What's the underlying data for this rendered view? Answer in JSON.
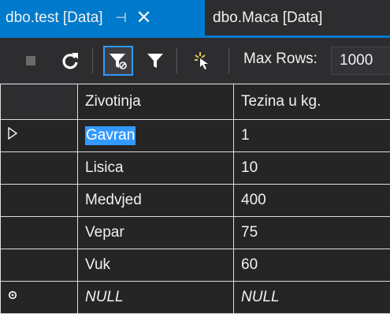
{
  "tabs": [
    {
      "label": "dbo.test [Data]",
      "active": true
    },
    {
      "label": "dbo.Maca [Data]",
      "active": false
    }
  ],
  "toolbar": {
    "max_rows_label": "Max Rows:",
    "max_rows_value": "1000"
  },
  "grid": {
    "columns": [
      "Zivotinja",
      "Tezina u kg."
    ],
    "rows": [
      {
        "zivotinja": "Gavran",
        "tezina": "1"
      },
      {
        "zivotinja": "Lisica",
        "tezina": "10"
      },
      {
        "zivotinja": "Medvjed",
        "tezina": "400"
      },
      {
        "zivotinja": "Vepar",
        "tezina": "75"
      },
      {
        "zivotinja": "Vuk",
        "tezina": "60"
      },
      {
        "zivotinja": "NULL",
        "tezina": "NULL"
      }
    ]
  },
  "colors": {
    "accent": "#007acc",
    "selection": "#3399ff",
    "background": "#252526"
  },
  "icons": [
    "pin-icon",
    "close-icon",
    "stop-icon",
    "refresh-icon",
    "filter-icon",
    "filter-icon",
    "execute-icon",
    "row-indicator-icon",
    "new-row-icon"
  ]
}
